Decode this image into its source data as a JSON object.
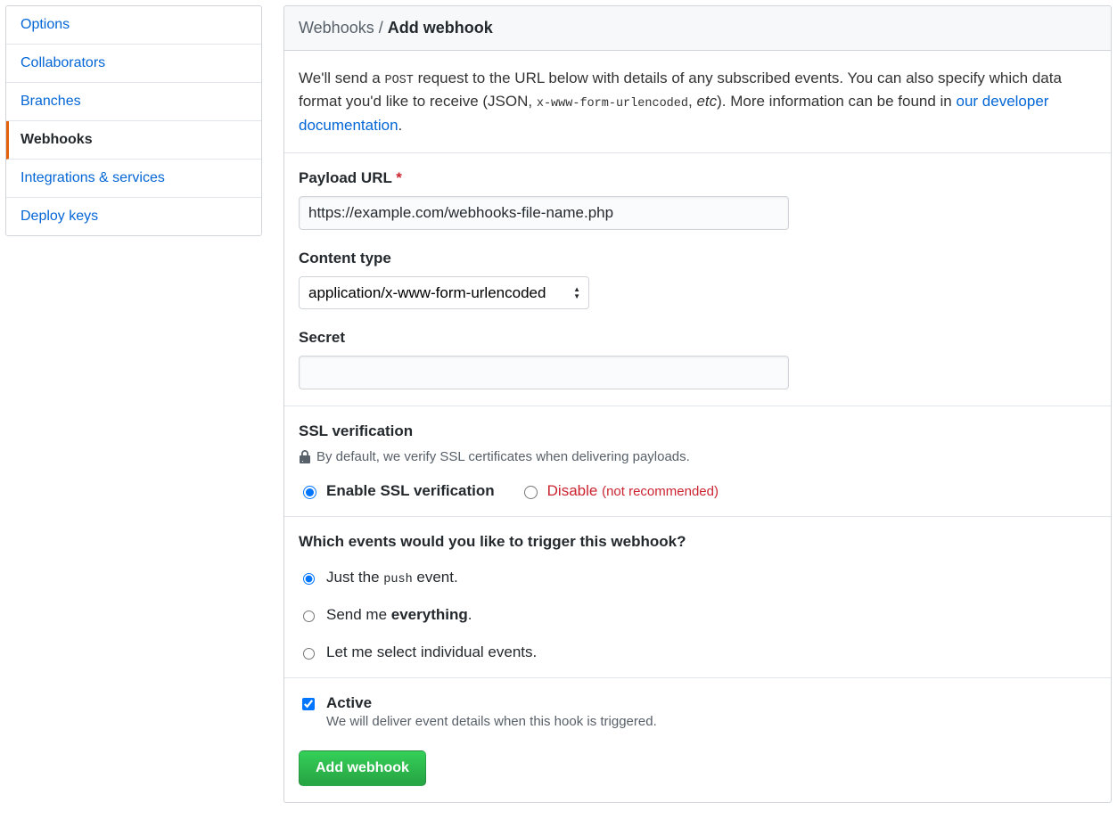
{
  "sidebar": {
    "items": [
      {
        "label": "Options",
        "selected": false
      },
      {
        "label": "Collaborators",
        "selected": false
      },
      {
        "label": "Branches",
        "selected": false
      },
      {
        "label": "Webhooks",
        "selected": true
      },
      {
        "label": "Integrations & services",
        "selected": false
      },
      {
        "label": "Deploy keys",
        "selected": false
      }
    ]
  },
  "header": {
    "breadcrumb_parent": "Webhooks",
    "breadcrumb_separator": "/",
    "breadcrumb_current": "Add webhook"
  },
  "intro": {
    "text_before_post": "We'll send a ",
    "post_code": "POST",
    "text_after_post": " request to the URL below with details of any subscribed events. You can also specify which data format you'd like to receive (JSON, ",
    "encoding_code": "x-www-form-urlencoded",
    "etc_sep": ", ",
    "etc": "etc",
    "text_after_etc": "). More information can be found in ",
    "link_text": "our developer documentation",
    "period": "."
  },
  "form": {
    "payload_url_label": "Payload URL",
    "required_mark": "*",
    "payload_url_value": "https://example.com/webhooks-file-name.php",
    "content_type_label": "Content type",
    "content_type_value": "application/x-www-form-urlencoded",
    "secret_label": "Secret",
    "secret_value": ""
  },
  "ssl": {
    "heading": "SSL verification",
    "note": "By default, we verify SSL certificates when delivering payloads.",
    "enable_label": "Enable SSL verification",
    "disable_label": "Disable",
    "disable_note": "(not recommended)"
  },
  "events": {
    "heading": "Which events would you like to trigger this webhook?",
    "opt_push_before": "Just the ",
    "opt_push_code": "push",
    "opt_push_after": " event.",
    "opt_everything_before": "Send me ",
    "opt_everything_strong": "everything",
    "opt_everything_after": ".",
    "opt_individual": "Let me select individual events."
  },
  "active": {
    "label": "Active",
    "description": "We will deliver event details when this hook is triggered."
  },
  "submit_label": "Add webhook"
}
